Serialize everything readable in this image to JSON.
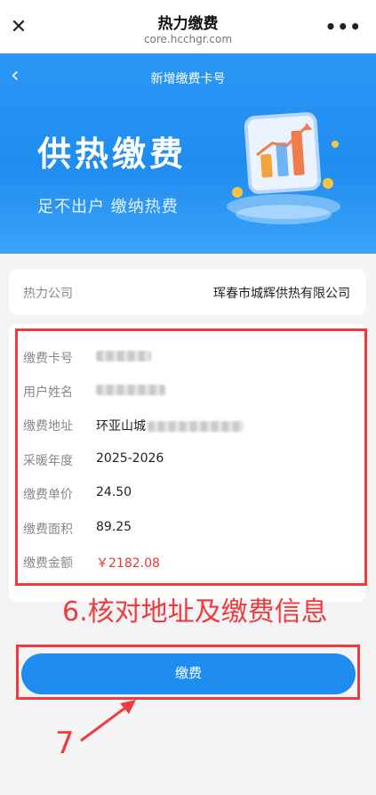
{
  "topbar": {
    "close_glyph": "✕",
    "title": "热力缴费",
    "url": "core.hcchgr.com",
    "more_glyph": "•••"
  },
  "banner": {
    "back_glyph": "‹",
    "nav_title": "新增缴费卡号",
    "headline": "供热缴费",
    "subtitle": "足不出户 缴纳热费"
  },
  "company": {
    "label": "热力公司",
    "value": "珲春市城辉供热有限公司"
  },
  "info": {
    "rows": [
      {
        "label": "缴费卡号",
        "value": ""
      },
      {
        "label": "用户姓名",
        "value": ""
      },
      {
        "label": "缴费地址",
        "value": "环亚山城"
      },
      {
        "label": "采暖年度",
        "value": "2025-2026"
      },
      {
        "label": "缴费单价",
        "value": "24.50"
      },
      {
        "label": "缴费面积",
        "value": "89.25"
      },
      {
        "label": "缴费金额",
        "value": "￥2182.08"
      }
    ]
  },
  "annotations": {
    "note6": "6.核对地址及缴费信息",
    "note7": "7"
  },
  "pay_button": {
    "label": "缴费"
  },
  "colors": {
    "brand_blue": "#1f8cf0",
    "annotation_red": "#ef3b3b",
    "amount_red": "#e23b3b"
  },
  "icons": [
    "close-icon",
    "more-icon",
    "back-icon",
    "chart-illustration",
    "arrow-annotation"
  ]
}
